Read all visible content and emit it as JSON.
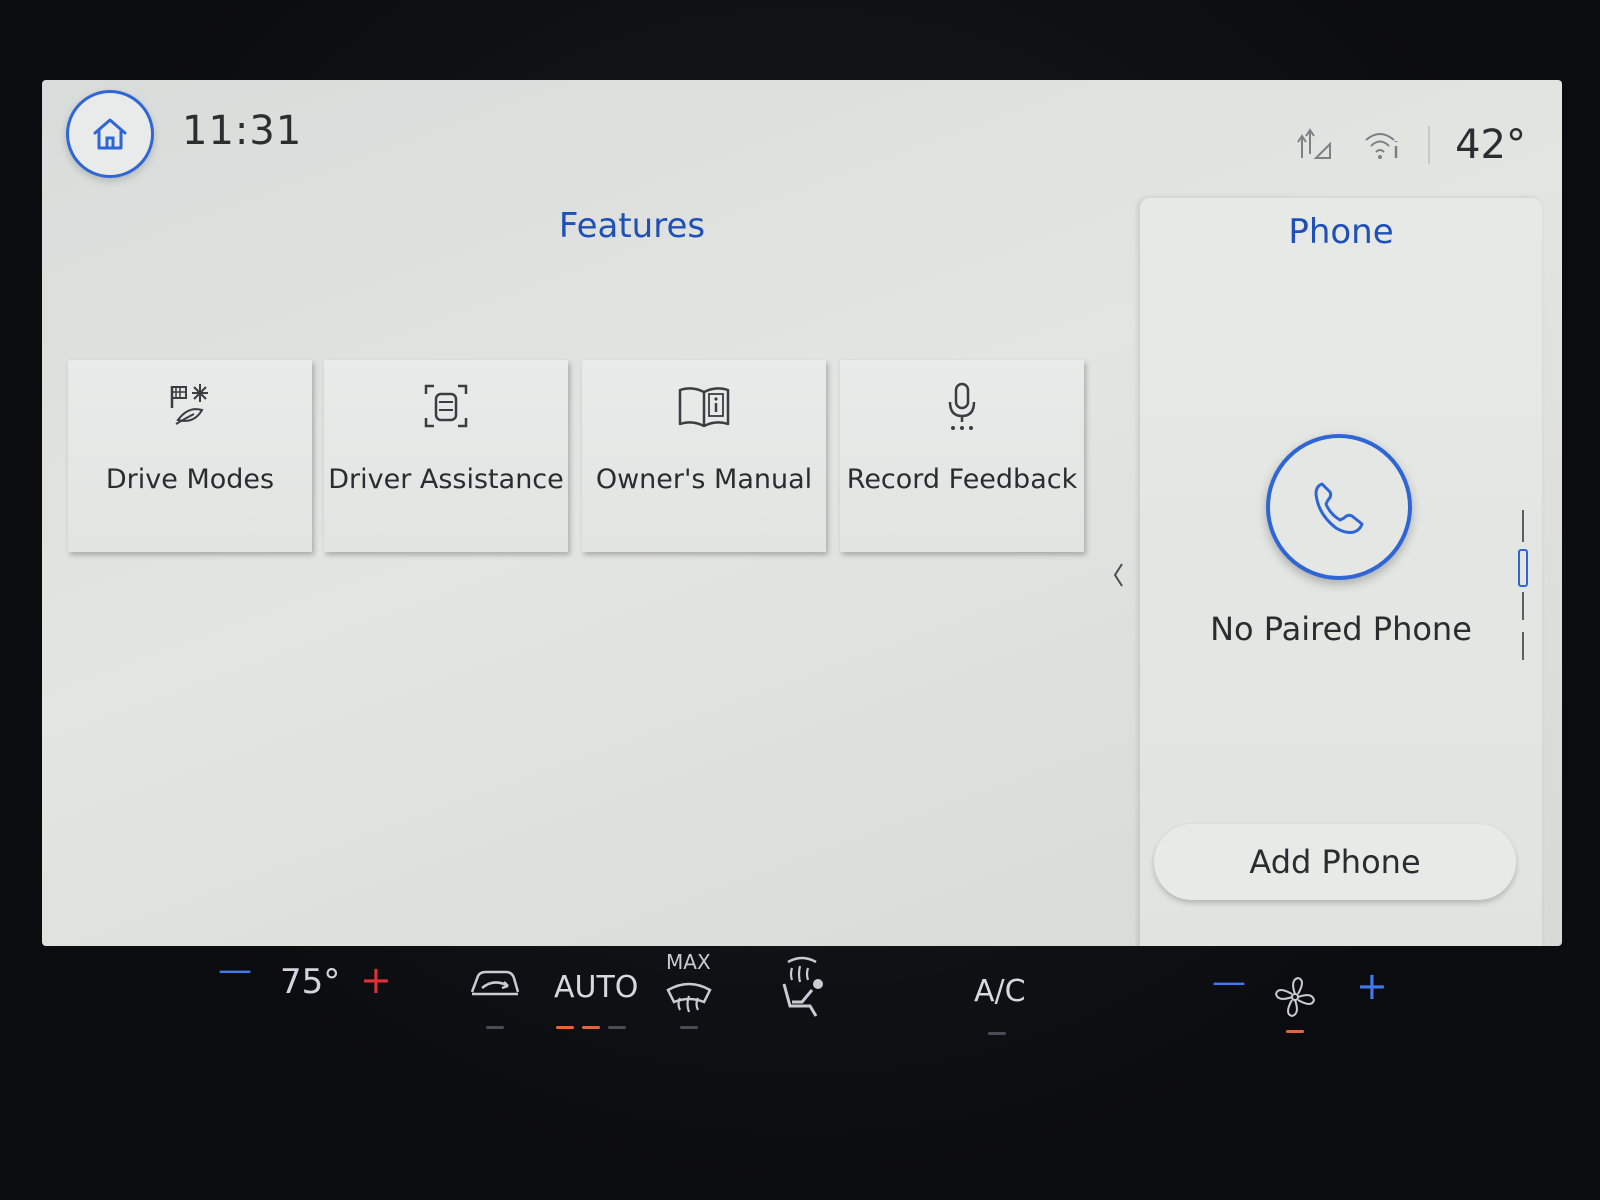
{
  "status": {
    "time": "11:31",
    "outside_temp": "42°"
  },
  "features": {
    "title": "Features",
    "tiles": [
      {
        "label": "Drive Modes",
        "icon": "drive-modes-icon"
      },
      {
        "label": "Driver Assistance",
        "icon": "driver-assistance-icon"
      },
      {
        "label": "Owner's Manual",
        "icon": "owners-manual-icon"
      },
      {
        "label": "Record Feedback",
        "icon": "microphone-icon"
      }
    ]
  },
  "phone": {
    "title": "Phone",
    "status": "No Paired Phone",
    "add_label": "Add Phone"
  },
  "climate": {
    "driver_temp": "75°",
    "auto_label": "AUTO",
    "max_label": "MAX",
    "ac_label": "A/C"
  },
  "colors": {
    "accent_blue": "#1f4fb8",
    "ring_blue": "#2f66d6",
    "increase_red": "#e0303a",
    "indicator_orange": "#e8633a"
  }
}
